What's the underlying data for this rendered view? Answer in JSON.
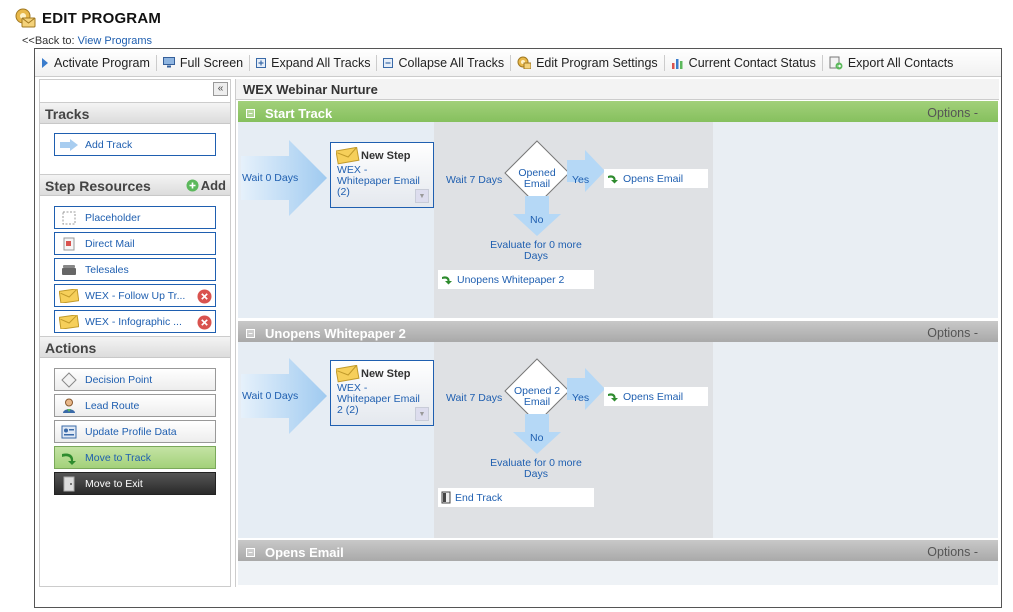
{
  "page": {
    "title": "EDIT PROGRAM",
    "back_prefix": "<<Back to:",
    "back_link": "View Programs"
  },
  "toolbar": {
    "activate": "Activate Program",
    "fullscreen": "Full Screen",
    "expand": "Expand All Tracks",
    "collapse": "Collapse All Tracks",
    "settings": "Edit Program Settings",
    "status": "Current Contact Status",
    "export": "Export All Contacts"
  },
  "sidebar": {
    "collapse_glyph": "«",
    "tracks_header": "Tracks",
    "add_track": "Add Track",
    "resources_header": "Step Resources",
    "add_resource": "Add",
    "resources": [
      {
        "label": "Placeholder",
        "icon": "placeholder-icon"
      },
      {
        "label": "Direct Mail",
        "icon": "direct-mail-icon"
      },
      {
        "label": "Telesales",
        "icon": "telephone-icon"
      },
      {
        "label": "WEX - Follow Up Tr...",
        "icon": "email-icon",
        "deletable": true
      },
      {
        "label": "WEX - Infographic ...",
        "icon": "email-icon",
        "deletable": true
      }
    ],
    "actions_header": "Actions",
    "actions": [
      {
        "label": "Decision Point",
        "icon": "diamond-icon"
      },
      {
        "label": "Lead Route",
        "icon": "person-icon"
      },
      {
        "label": "Update Profile Data",
        "icon": "profile-card-icon"
      },
      {
        "label": "Move to Track",
        "icon": "arrow-curve-icon"
      },
      {
        "label": "Move to Exit",
        "icon": "exit-door-icon"
      }
    ]
  },
  "program": {
    "name": "WEX Webinar Nurture",
    "options_label": "Options -",
    "tracks": [
      {
        "name": "Start Track",
        "color": "#8cc464",
        "wait": "Wait 0 Days",
        "step_title": "New Step",
        "step_desc": "WEX - Whitepaper Email (2)",
        "decision_wait": "Wait 7 Days",
        "decision": "Opened Email",
        "yes": "Yes",
        "no": "No",
        "yes_target": "Opens Email",
        "evaluate": "Evaluate for 0 more Days",
        "no_target": "Unopens Whitepaper 2"
      },
      {
        "name": "Unopens Whitepaper 2",
        "color": "#b0b0b0",
        "wait": "Wait 0 Days",
        "step_title": "New Step",
        "step_desc": "WEX - Whitepaper Email 2 (2)",
        "decision_wait": "Wait 7 Days",
        "decision": "Opened 2 Email",
        "yes": "Yes",
        "no": "No",
        "yes_target": "Opens Email",
        "evaluate": "Evaluate for 0 more Days",
        "no_target": "End Track"
      },
      {
        "name": "Opens Email",
        "color": "#b0b0b0"
      }
    ]
  }
}
